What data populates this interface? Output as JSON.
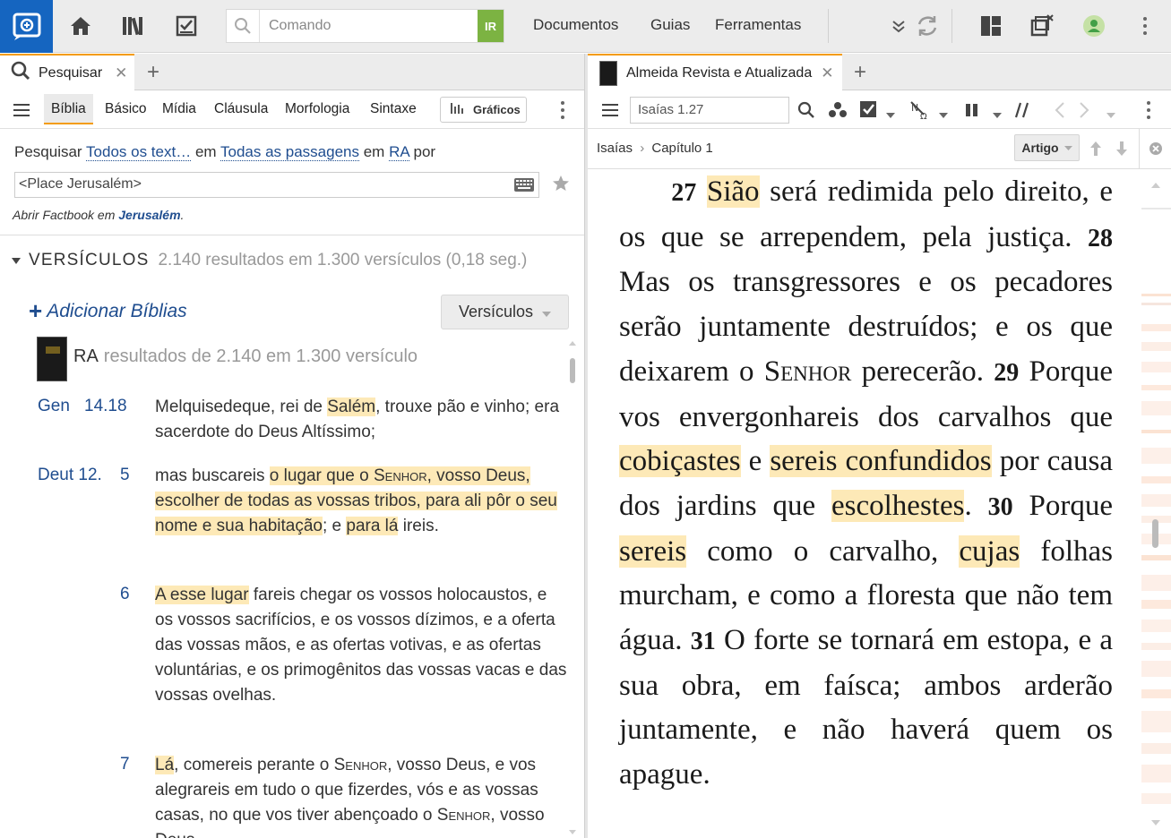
{
  "toolbar": {
    "command_placeholder": "Comando",
    "ir_badge": "IR",
    "menu": [
      "Documentos",
      "Guias",
      "Ferramentas"
    ]
  },
  "left": {
    "tab_label": "Pesquisar",
    "subtabs": [
      "Bíblia",
      "Básico",
      "Mídia",
      "Cláusula",
      "Morfologia",
      "Sintaxe"
    ],
    "graficos_label": "Gráficos",
    "search": {
      "pesquisar": "Pesquisar",
      "scope": "Todos os text…",
      "em1": "em",
      "passages": "Todas as passagens",
      "em2": "em",
      "version": "RA",
      "por": "por",
      "query": "<Place Jerusalém>",
      "factbook_prefix": "Abrir Factbook em",
      "factbook_term": "Jerusalém",
      "factbook_suffix": "."
    },
    "results_header": {
      "title": "VERSÍCULOS",
      "summary": "2.140 resultados em 1.300 versículos (0,18 seg.)"
    },
    "add_bibles": "Adicionar Bíblias",
    "view_button": "Versículos",
    "ra_label": "RA",
    "ra_summary": "resultados de 2.140 em 1.300 versículo",
    "results": [
      {
        "book": "Gen",
        "chapter": "14.18",
        "verse": ""
      },
      {
        "book": "Deut 12.",
        "chapter": "",
        "verse": "5"
      },
      {
        "book": "",
        "chapter": "",
        "verse": "6"
      },
      {
        "book": "",
        "chapter": "",
        "verse": "7"
      }
    ]
  },
  "right": {
    "tab_label": "Almeida Revista e Atualizada",
    "reference": "Isaías 1.27",
    "breadcrumb_book": "Isaías",
    "breadcrumb_sep": "›",
    "breadcrumb_chapter": "Capítulo 1",
    "artigo_label": "Artigo"
  },
  "colors": {
    "brand": "#1565c0",
    "highlight": "#fde9b7",
    "tab_accent": "#f39c12",
    "link": "#1f4d8f",
    "ir_badge": "#7cb342"
  },
  "icons": [
    "app-logo-icon",
    "home-icon",
    "library-icon",
    "checklist-icon",
    "search-icon",
    "chevron-down-icon",
    "sync-icon",
    "layout-icon",
    "close-panels-icon",
    "user-status-icon",
    "kebab-icon",
    "keyboard-icon",
    "star-icon",
    "chart-icon"
  ]
}
